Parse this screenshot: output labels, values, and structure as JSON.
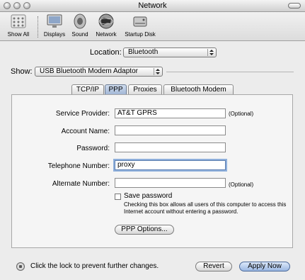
{
  "window": {
    "title": "Network"
  },
  "toolbar": {
    "items": [
      {
        "label": "Show All",
        "icon": "apple-icon"
      },
      {
        "label": "Displays",
        "icon": "display-icon"
      },
      {
        "label": "Sound",
        "icon": "speaker-icon"
      },
      {
        "label": "Network",
        "icon": "globe-icon"
      },
      {
        "label": "Startup Disk",
        "icon": "disk-icon"
      }
    ]
  },
  "location": {
    "label": "Location:",
    "value": "Bluetooth"
  },
  "show": {
    "label": "Show:",
    "value": "USB Bluetooth Modem Adaptor"
  },
  "tabs": [
    {
      "label": "TCP/IP",
      "selected": false
    },
    {
      "label": "PPP",
      "selected": true
    },
    {
      "label": "Proxies",
      "selected": false
    },
    {
      "label": "Bluetooth Modem",
      "selected": false
    }
  ],
  "form": {
    "service_provider": {
      "label": "Service Provider:",
      "value": "AT&T GPRS",
      "note": "(Optional)"
    },
    "account_name": {
      "label": "Account Name:",
      "value": ""
    },
    "password": {
      "label": "Password:",
      "value": ""
    },
    "telephone_number": {
      "label": "Telephone Number:",
      "value": "proxy"
    },
    "alternate_number": {
      "label": "Alternate Number:",
      "value": "",
      "note": "(Optional)"
    },
    "save_password": {
      "label": "Save password",
      "checked": false,
      "help": "Checking this box allows all users of this computer to access this Internet account without entering a password."
    },
    "ppp_options_button": "PPP Options..."
  },
  "footer": {
    "lock_text": "Click the lock to prevent further changes.",
    "revert_button": "Revert",
    "apply_button": "Apply Now"
  }
}
